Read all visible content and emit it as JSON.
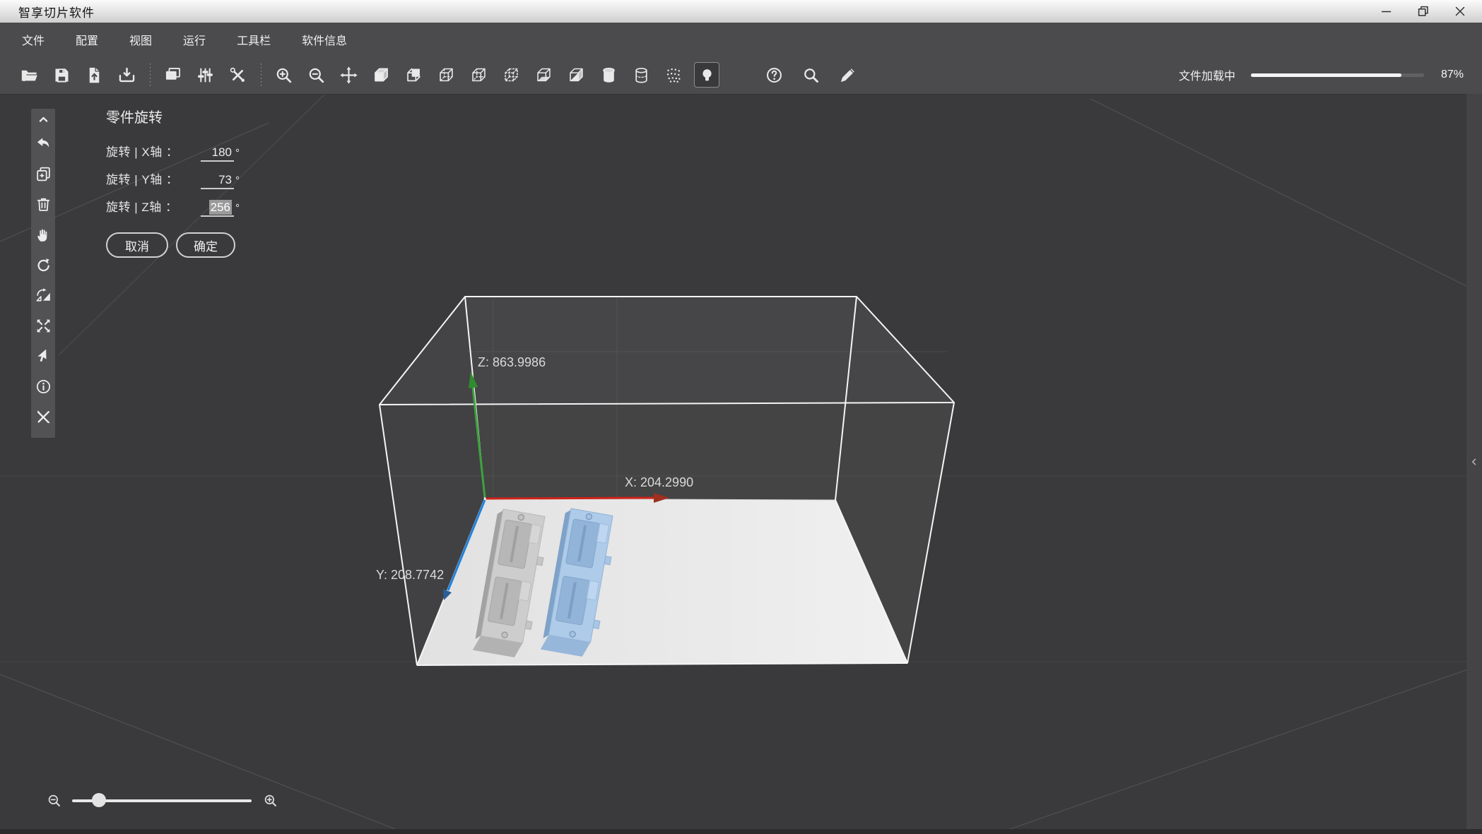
{
  "titlebar": {
    "title": "智享切片软件",
    "controls": [
      "minimize",
      "restore",
      "close"
    ]
  },
  "menubar": {
    "items": [
      "文件",
      "配置",
      "视图",
      "运行",
      "工具栏",
      "软件信息"
    ]
  },
  "toolbar": {
    "groups": [
      [
        "open-folder",
        "save",
        "export-file",
        "import-tray"
      ],
      [
        "display-settings",
        "adjust-sliders",
        "tools-wrench"
      ],
      [
        "zoom-in",
        "zoom-out",
        "move",
        "cube-solid",
        "cube-back-face",
        "cube-hidden-dashed",
        "cube-inner-axes",
        "cube-dotted",
        "cube-bottom-face",
        "cube-diagonal",
        "cylinder-solid",
        "cylinder-wireframe",
        "point-cloud",
        "light-bulb"
      ]
    ],
    "active_icon": "light-bulb",
    "right_icons": [
      "help",
      "probe-search",
      "pen"
    ],
    "progress": {
      "label": "文件加载中",
      "value": 87,
      "percent_label": "87%"
    }
  },
  "side_toolbar": {
    "icons": [
      "collapse-up",
      "undo",
      "add-copy",
      "delete-trash",
      "pan-hand",
      "rotate-ccw",
      "mirror-flip",
      "expand-arrows",
      "select-cursor",
      "info",
      "cross-tools"
    ]
  },
  "rotation_panel": {
    "title": "零件旋转",
    "rows": [
      {
        "axis": "x",
        "label": "旋转 | X轴 ：",
        "value": "180",
        "unit": "°",
        "selected": false
      },
      {
        "axis": "y",
        "label": "旋转 | Y轴 ：",
        "value": "73",
        "unit": "°",
        "selected": false
      },
      {
        "axis": "z",
        "label": "旋转 | Z轴 ：",
        "value": "256",
        "unit": "°",
        "selected": true
      }
    ],
    "buttons": {
      "cancel": "取消",
      "ok": "确定"
    }
  },
  "viewport": {
    "axes": {
      "x_label": "X: 204.2990",
      "y_label": "Y: 208.7742",
      "z_label": "Z: 863.9986",
      "x_color": "#d02318",
      "y_color": "#1e82dd",
      "z_color": "#3da23d"
    },
    "parts": [
      {
        "name": "part-1",
        "color": "#cdcdcd",
        "selected": false
      },
      {
        "name": "part-2",
        "color": "#aecbe9",
        "selected": true
      }
    ]
  },
  "zoom_control": {
    "min_icon": "zoom-out-glass",
    "max_icon": "zoom-in-glass",
    "position": 15
  },
  "right_edge": {
    "icon": "chevron-left"
  }
}
